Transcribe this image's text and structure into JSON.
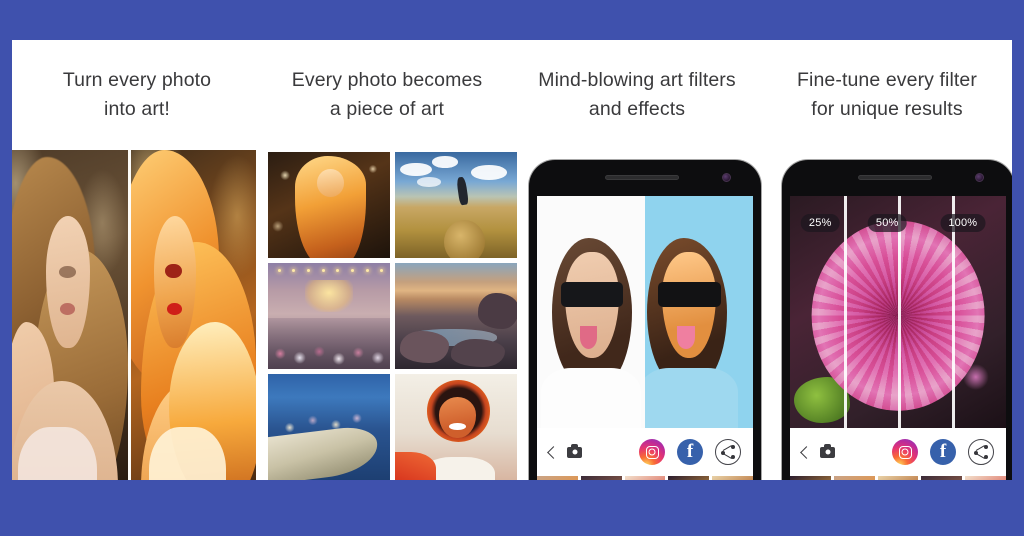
{
  "theme": {
    "frame_color": "#3f51ad",
    "panel_background": "#ffffff",
    "caption_color": "#3a3a3c",
    "instagram_gradient": "#e6376f",
    "facebook_blue": "#3761ab",
    "share_outline": "#44444a"
  },
  "captions": [
    {
      "text": "Turn every photo\ninto art!"
    },
    {
      "text": "Every photo becomes\na piece of art"
    },
    {
      "text": "Mind-blowing art filters\nand effects"
    },
    {
      "text": "Fine-tune every filter\nfor unique results"
    }
  ],
  "hero": {
    "name": "before-after-portrait",
    "left_label": "original photo",
    "right_label": "art filter applied"
  },
  "thumbnails": [
    {
      "name": "blonde-portrait-art"
    },
    {
      "name": "field-jumper-art"
    },
    {
      "name": "street-festival-art"
    },
    {
      "name": "rocky-coast-sunset-art"
    },
    {
      "name": "boat-people-art"
    },
    {
      "name": "smiling-woman-art"
    }
  ],
  "phones": [
    {
      "name": "phone-art-filter-preview",
      "photo": "man-sunglasses-split",
      "toolbar": {
        "back": "back-chevron",
        "camera": "camera",
        "instagram": "Instagram",
        "facebook": "f",
        "share": "Share"
      }
    },
    {
      "name": "phone-filter-intensity",
      "photo": "pink-dahlia-flower",
      "intensity_labels": [
        "25%",
        "50%",
        "100%"
      ],
      "toolbar": {
        "back": "back-chevron",
        "camera": "camera",
        "instagram": "Instagram",
        "facebook": "f",
        "share": "Share"
      }
    }
  ],
  "filmstrip": {
    "name": "filter-preview-strip",
    "items": [
      "filter-1",
      "filter-2",
      "filter-3",
      "filter-4",
      "filter-5"
    ]
  }
}
